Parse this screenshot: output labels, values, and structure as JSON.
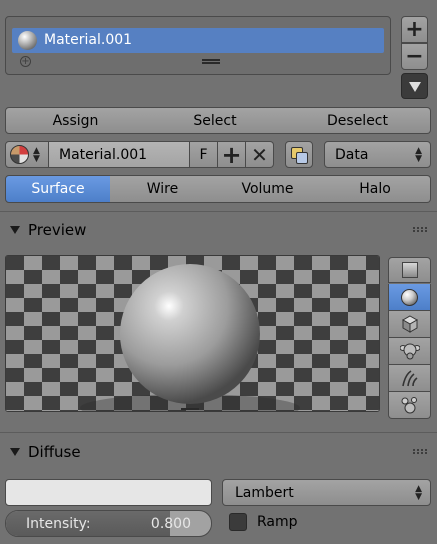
{
  "material_slots": {
    "items": [
      {
        "label": "Material.001",
        "selected": true
      }
    ],
    "add_icon": "plus-icon",
    "remove_icon": "minus-icon",
    "specials_icon": "triangle-down-icon"
  },
  "slot_actions": {
    "assign": "Assign",
    "select": "Select",
    "deselect": "Deselect"
  },
  "datablock": {
    "name": "Material.001",
    "fake_user": "F",
    "link": "Data"
  },
  "type_tabs": {
    "items": [
      {
        "label": "Surface",
        "active": true
      },
      {
        "label": "Wire",
        "active": false
      },
      {
        "label": "Volume",
        "active": false
      },
      {
        "label": "Halo",
        "active": false
      }
    ]
  },
  "preview": {
    "title": "Preview",
    "shapes": [
      "flat-icon",
      "sphere-icon",
      "cube-icon",
      "monkey-icon",
      "hair-icon",
      "sphere-a-lot-icon"
    ],
    "active_shape": "sphere-icon"
  },
  "diffuse": {
    "title": "Diffuse",
    "color": "#e6e6e6",
    "shader": "Lambert",
    "intensity_label": "Intensity:",
    "intensity_value": "0.800",
    "intensity_fraction": 0.8,
    "ramp_label": "Ramp",
    "ramp_checked": false
  },
  "colors": {
    "accent": "#5680c2",
    "background": "#727272"
  }
}
